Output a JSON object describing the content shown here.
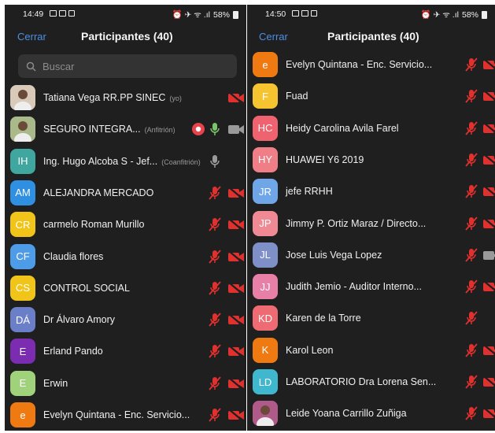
{
  "left": {
    "time": "14:49",
    "battery": "58%",
    "close_label": "Cerrar",
    "title": "Participantes (40)",
    "search_placeholder": "Buscar",
    "participants": [
      {
        "initials": "",
        "name": "Tatiana Vega RR.PP SINEC",
        "role": "(yo)",
        "color": "#d8c9b8",
        "mic": "none",
        "cam": "off",
        "photo": true
      },
      {
        "initials": "",
        "name": "SEGURO INTEGRA...",
        "role": "(Anfitrión)",
        "color": "#a9b98a",
        "mic": "on",
        "cam": "on-gray",
        "rec": true,
        "photo": true
      },
      {
        "initials": "IH",
        "name": "Ing. Hugo Alcoba S - Jef...",
        "role": "(Coanfitrión)",
        "color": "#3fa7a0",
        "mic": "on-gray",
        "cam": "none"
      },
      {
        "initials": "AM",
        "name": "ALEJANDRA MERCADO",
        "role": "",
        "color": "#2f8fe0",
        "mic": "off",
        "cam": "off"
      },
      {
        "initials": "CR",
        "name": "carmelo Roman Murillo",
        "role": "",
        "color": "#f0c419",
        "mic": "off",
        "cam": "off"
      },
      {
        "initials": "CF",
        "name": "Claudia flores",
        "role": "",
        "color": "#4e9be8",
        "mic": "off",
        "cam": "off"
      },
      {
        "initials": "CS",
        "name": "CONTROL SOCIAL",
        "role": "",
        "color": "#f0c419",
        "mic": "off",
        "cam": "off"
      },
      {
        "initials": "DÁ",
        "name": "Dr Álvaro Amory",
        "role": "",
        "color": "#6b7fc8",
        "mic": "off",
        "cam": "off"
      },
      {
        "initials": "E",
        "name": "Erland Pando",
        "role": "",
        "color": "#7b2cb0",
        "mic": "off",
        "cam": "off"
      },
      {
        "initials": "E",
        "name": "Erwin",
        "role": "",
        "color": "#9fd27a",
        "mic": "off",
        "cam": "off"
      },
      {
        "initials": "e",
        "name": "Evelyn Quintana - Enc. Servicio...",
        "role": "",
        "color": "#f07a12",
        "mic": "off",
        "cam": "off"
      }
    ]
  },
  "right": {
    "time": "14:50",
    "battery": "58%",
    "close_label": "Cerrar",
    "title": "Participantes (40)",
    "participants": [
      {
        "initials": "e",
        "name": "Evelyn Quintana - Enc. Servicio...",
        "color": "#f07a12",
        "mic": "off",
        "cam": "off"
      },
      {
        "initials": "F",
        "name": "Fuad",
        "color": "#f5c430",
        "mic": "off",
        "cam": "off"
      },
      {
        "initials": "HC",
        "name": "Heidy Carolina Avila Farel",
        "color": "#ef6270",
        "mic": "off",
        "cam": "off"
      },
      {
        "initials": "HY",
        "name": "HUAWEI Y6 2019",
        "color": "#ef7e86",
        "mic": "off",
        "cam": "off"
      },
      {
        "initials": "JR",
        "name": "jefe RRHH",
        "color": "#6fa6e8",
        "mic": "off",
        "cam": "off"
      },
      {
        "initials": "JP",
        "name": "Jimmy P. Ortiz Maraz / Directo...",
        "color": "#ef8a94",
        "mic": "off",
        "cam": "off"
      },
      {
        "initials": "JL",
        "name": "Jose Luis Vega Lopez",
        "color": "#7f8fc8",
        "mic": "off",
        "cam": "on-gray"
      },
      {
        "initials": "JJ",
        "name": "Judith Jemio - Auditor Interno...",
        "color": "#e77fa6",
        "mic": "off",
        "cam": "off"
      },
      {
        "initials": "KD",
        "name": "Karen de la Torre",
        "color": "#ee6b73",
        "mic": "off",
        "cam": "none"
      },
      {
        "initials": "K",
        "name": "Karol Leon",
        "color": "#f07a12",
        "mic": "off",
        "cam": "off"
      },
      {
        "initials": "LD",
        "name": "LABORATORIO Dra Lorena Sen...",
        "color": "#3fb8cf",
        "mic": "off",
        "cam": "off"
      },
      {
        "initials": "",
        "name": "Leide Yoana Carrillo Zuñiga",
        "color": "#b05a8a",
        "mic": "off",
        "cam": "off",
        "photo": true
      }
    ]
  },
  "colors": {
    "accent": "#4d8fe6",
    "muted_red": "#e0312f",
    "record": "#e8434a",
    "mic_green": "#7cc46b"
  }
}
